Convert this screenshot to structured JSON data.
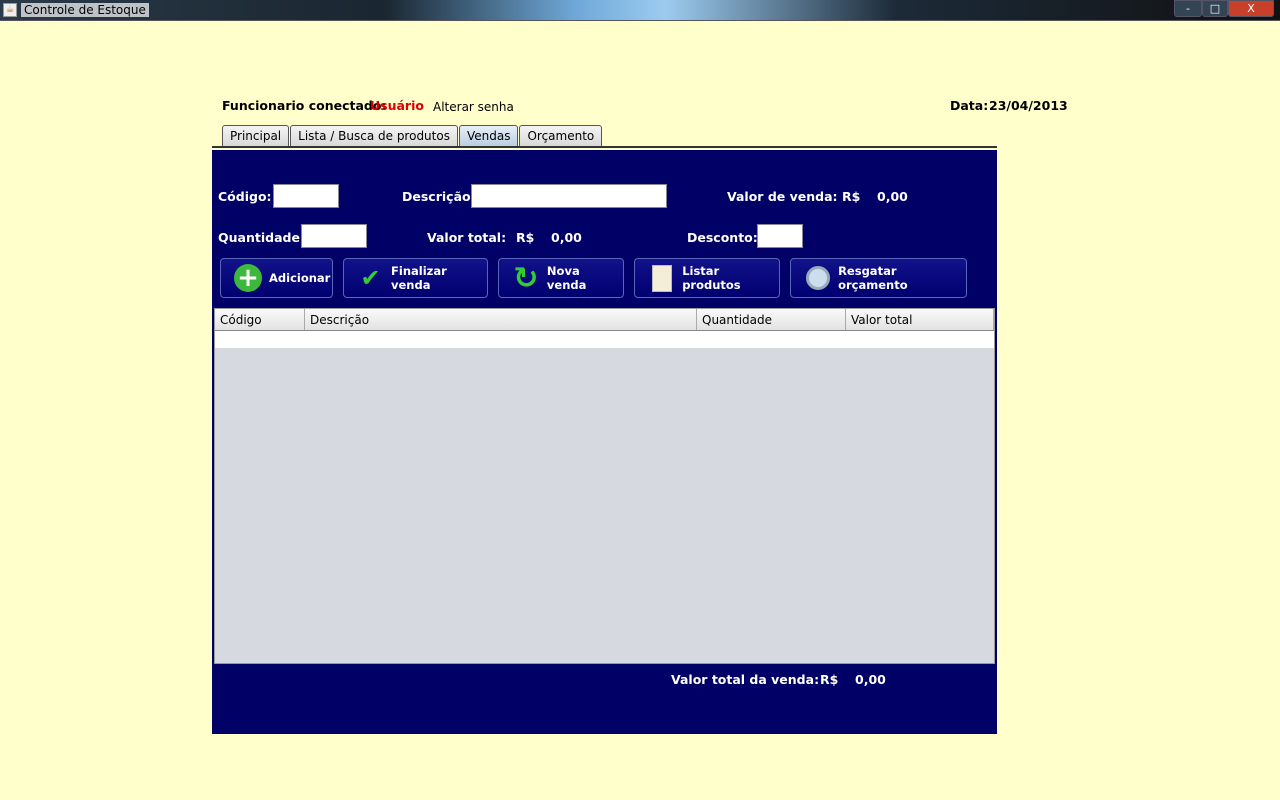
{
  "window": {
    "title": "Controle de Estoque",
    "min": "-",
    "max": "□",
    "close": "X"
  },
  "header": {
    "user_label": "Funcionario conectado:",
    "user": "Usuário",
    "change_password": "Alterar senha",
    "date_label": "Data:",
    "date": "23/04/2013"
  },
  "tabs": [
    "Principal",
    "Lista / Busca de produtos",
    "Vendas",
    "Orçamento"
  ],
  "form": {
    "codigo_label": "Código:",
    "descricao_label": "Descrição:",
    "valor_venda_label": "Valor de venda:",
    "currency": "R$",
    "valor_venda": "0,00",
    "quantidade_label": "Quantidade:",
    "valor_total_label": "Valor total:",
    "valor_total": "0,00",
    "desconto_label": "Desconto:",
    "codigo": "",
    "descricao": "",
    "quantidade": "",
    "desconto": ""
  },
  "buttons": {
    "adicionar": "Adicionar",
    "finalizar": "Finalizar venda",
    "nova": "Nova venda",
    "listar": "Listar produtos",
    "resgatar": "Resgatar orçamento"
  },
  "table": {
    "columns": [
      "Código",
      "Descrição",
      "Quantidade",
      "Valor total"
    ]
  },
  "footer": {
    "label": "Valor total da venda:",
    "currency": "R$",
    "value": "0,00"
  },
  "colors": {
    "panel": "#000066",
    "background": "#ffffcc",
    "user": "#dd0000"
  }
}
